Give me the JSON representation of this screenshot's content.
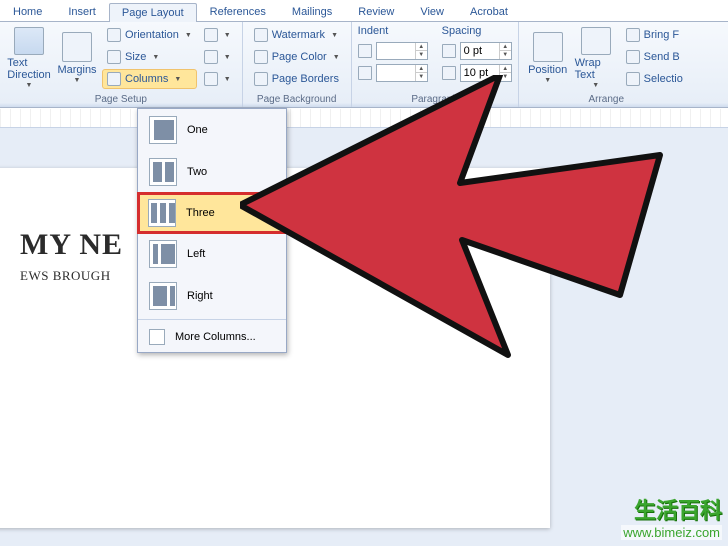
{
  "tabs": [
    "Home",
    "Insert",
    "Page Layout",
    "References",
    "Mailings",
    "Review",
    "View",
    "Acrobat"
  ],
  "active_tab": 2,
  "ribbon": {
    "pagesetup": {
      "label": "Page Setup",
      "text_direction": "Text Direction",
      "margins": "Margins",
      "orientation": "Orientation",
      "size": "Size",
      "columns": "Columns"
    },
    "pagebg": {
      "label": "Page Background",
      "watermark": "Watermark",
      "page_color": "Page Color",
      "page_borders": "Page Borders"
    },
    "paragraph": {
      "label": "Paragraph",
      "indent_lbl": "Indent",
      "spacing_lbl": "Spacing",
      "before_val": "0 pt",
      "after_val": "10 pt"
    },
    "arrange": {
      "label": "Arrange",
      "position": "Position",
      "wrap_text": "Wrap Text",
      "bring_f": "Bring F",
      "send_b": "Send B",
      "selectio": "Selectio"
    }
  },
  "columns_menu": {
    "items": [
      {
        "label": "One",
        "bars": [
          [
            4,
            20
          ]
        ]
      },
      {
        "label": "Two",
        "bars": [
          [
            3,
            9
          ],
          [
            15,
            9
          ]
        ]
      },
      {
        "label": "Three",
        "bars": [
          [
            2,
            6
          ],
          [
            11,
            6
          ],
          [
            20,
            6
          ]
        ]
      },
      {
        "label": "Left",
        "bars": [
          [
            3,
            5
          ],
          [
            11,
            14
          ]
        ]
      },
      {
        "label": "Right",
        "bars": [
          [
            3,
            14
          ],
          [
            20,
            5
          ]
        ]
      }
    ],
    "highlighted": "Three",
    "more": "More Columns..."
  },
  "document": {
    "headline_visible": "MY NE",
    "sub_visible": "EWS BROUGH"
  },
  "watermark": {
    "cn": "生活百科",
    "url": "www.bimeiz.com"
  }
}
